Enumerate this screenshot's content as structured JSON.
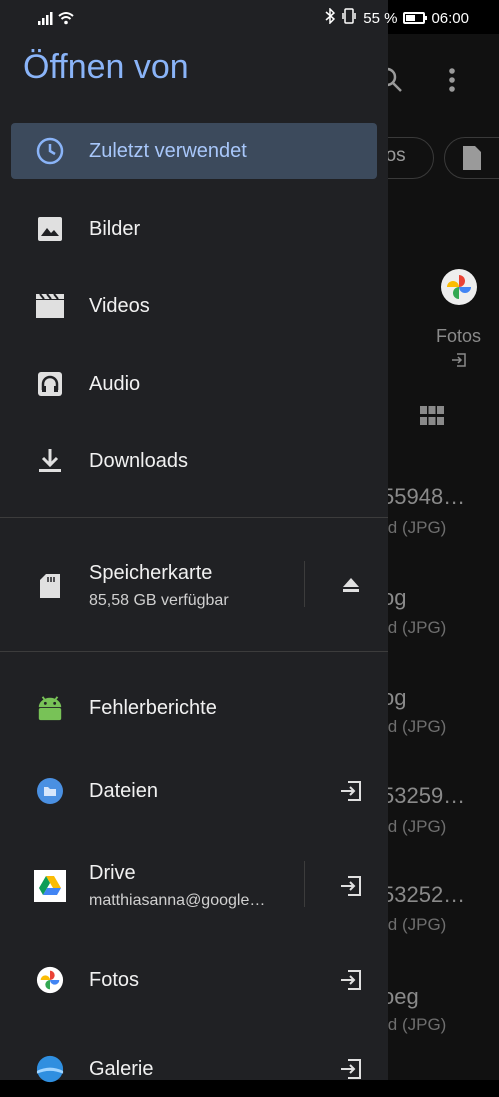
{
  "status_bar": {
    "battery": "55 %",
    "battery_level": 0.55,
    "time": "06:00"
  },
  "drawer": {
    "title": "Öffnen von",
    "recent": "Zuletzt verwendet",
    "images": "Bilder",
    "videos": "Videos",
    "audio": "Audio",
    "downloads": "Downloads",
    "sdcard": {
      "label": "Speicherkarte",
      "sub": "85,58 GB verfügbar"
    },
    "bugreports": "Fehlerberichte",
    "files": "Dateien",
    "drive": {
      "label": "Drive",
      "sub": "matthiasanna@google…"
    },
    "photos": "Fotos",
    "gallery": "Galerie"
  },
  "background": {
    "chip_text": "eos",
    "fotos_label": "Fotos",
    "files": [
      {
        "name": "55948…",
        "type": "ld (JPG)"
      },
      {
        "name": "og",
        "type": "ld (JPG)"
      },
      {
        "name": "og",
        "type": "ld (JPG)"
      },
      {
        "name": "53259…",
        "type": "ld (JPG)"
      },
      {
        "name": "53252…",
        "type": "ld (JPG)"
      },
      {
        "name": "oeg",
        "type": "ld (JPG)"
      }
    ]
  }
}
